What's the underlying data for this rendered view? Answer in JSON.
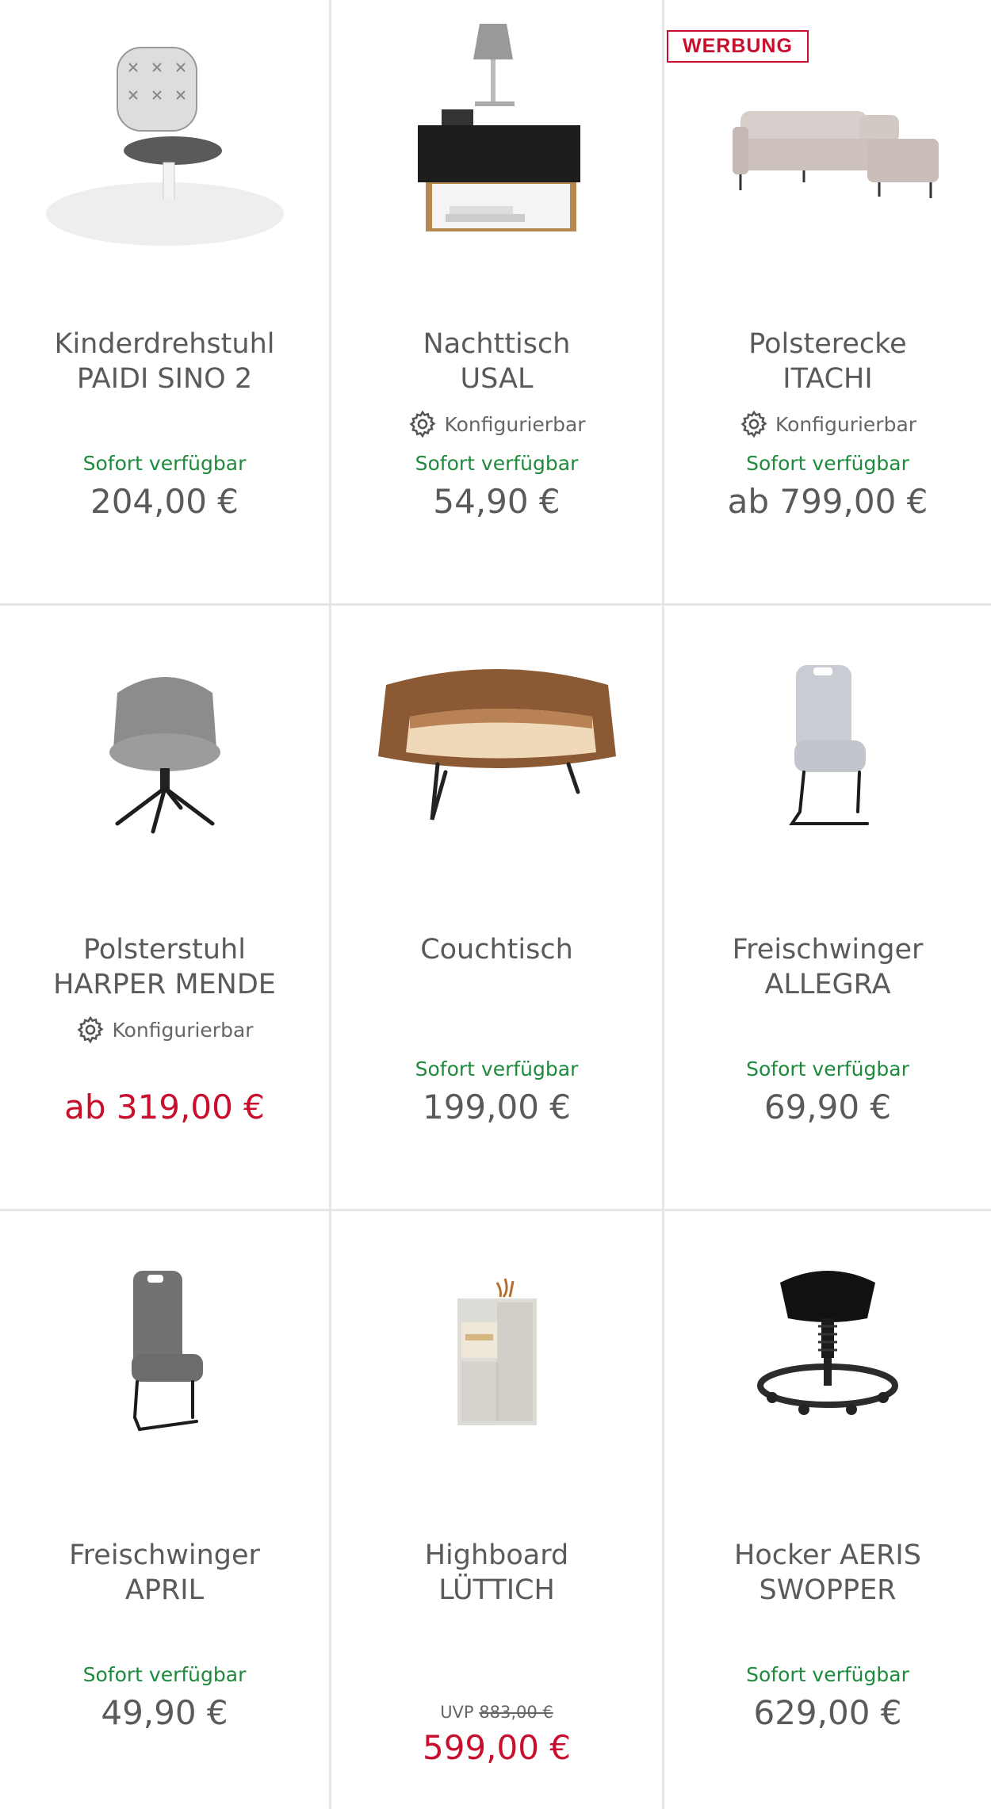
{
  "colors": {
    "available": "#1e8a3c",
    "sale": "#c8102e",
    "text": "#5a5a5a",
    "divider": "#e6e6e6"
  },
  "products": [
    {
      "title_line1": "Kinderdrehstuhl",
      "title_line2": "PAIDI SINO 2",
      "configurable": "",
      "availability": "Sofort verfügbar",
      "price": "204,00 €",
      "badge": "",
      "image_icon": "kids-office-chair-image"
    },
    {
      "title_line1": "Nachttisch",
      "title_line2": "USAL",
      "configurable": "Konfigurierbar",
      "availability": "Sofort verfügbar",
      "price": "54,90 €",
      "badge": "",
      "image_icon": "nightstand-with-lamp-image"
    },
    {
      "title_line1": "Polsterecke",
      "title_line2": "ITACHI",
      "configurable": "Konfigurierbar",
      "availability": "Sofort verfügbar",
      "price": "ab 799,00 €",
      "badge": "WERBUNG",
      "image_icon": "corner-sofa-image"
    },
    {
      "title_line1": "Polsterstuhl",
      "title_line2": "HARPER MENDE",
      "configurable": "Konfigurierbar",
      "availability": "",
      "price": "ab 319,00 €",
      "badge": "",
      "image_icon": "upholstered-swivel-chair-image"
    },
    {
      "title_line1": "Couchtisch",
      "title_line2": "",
      "configurable": "",
      "availability": "Sofort verfügbar",
      "price": "199,00 €",
      "badge": "",
      "image_icon": "wooden-coffee-table-image"
    },
    {
      "title_line1": "Freischwinger",
      "title_line2": "ALLEGRA",
      "configurable": "",
      "availability": "Sofort verfügbar",
      "price": "69,90 €",
      "badge": "",
      "image_icon": "cantilever-chair-light-image"
    },
    {
      "title_line1": "Freischwinger",
      "title_line2": "APRIL",
      "configurable": "",
      "availability": "Sofort verfügbar",
      "price": "49,90 €",
      "badge": "",
      "image_icon": "cantilever-chair-dark-image"
    },
    {
      "title_line1": "Highboard",
      "title_line2": "LÜTTICH",
      "configurable": "",
      "availability": "",
      "uvp_label": "UVP",
      "uvp_price": "883,00 €",
      "price": "599,00 €",
      "badge": "",
      "image_icon": "highboard-cabinet-image"
    },
    {
      "title_line1": "Hocker AERIS",
      "title_line2": "SWOPPER",
      "configurable": "",
      "availability": "Sofort verfügbar",
      "price": "629,00 €",
      "badge": "",
      "image_icon": "ergonomic-stool-image"
    }
  ]
}
